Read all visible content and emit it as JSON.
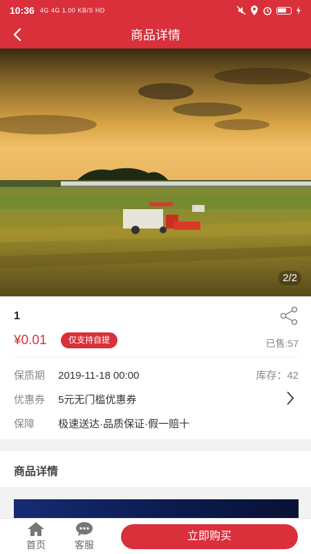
{
  "status_bar": {
    "time": "10:36",
    "network": "4G 4G 1.00 KB/S HD",
    "icons": [
      "mute-icon",
      "location-icon",
      "alarm-icon",
      "battery-icon"
    ]
  },
  "nav": {
    "title": "商品详情",
    "back_icon": "back-arrow-icon"
  },
  "gallery": {
    "pager": "2/2"
  },
  "product": {
    "name": "1",
    "price": "¥0.01",
    "tag": "仅支持自提",
    "sold": "已售:57",
    "shelf_life_label": "保质期",
    "shelf_life_value": "2019-11-18 00:00",
    "stock": "库存：42",
    "coupon_label": "优惠券",
    "coupon_value": "5元无门槛优惠券",
    "guarantee_label": "保障",
    "guarantee_value": "极速送达·品质保证·假一赔十"
  },
  "detail": {
    "header": "商品详情"
  },
  "bottom": {
    "home_label": "首页",
    "service_label": "客服",
    "buy_label": "立即购买"
  },
  "colors": {
    "brand": "#d9303b"
  }
}
